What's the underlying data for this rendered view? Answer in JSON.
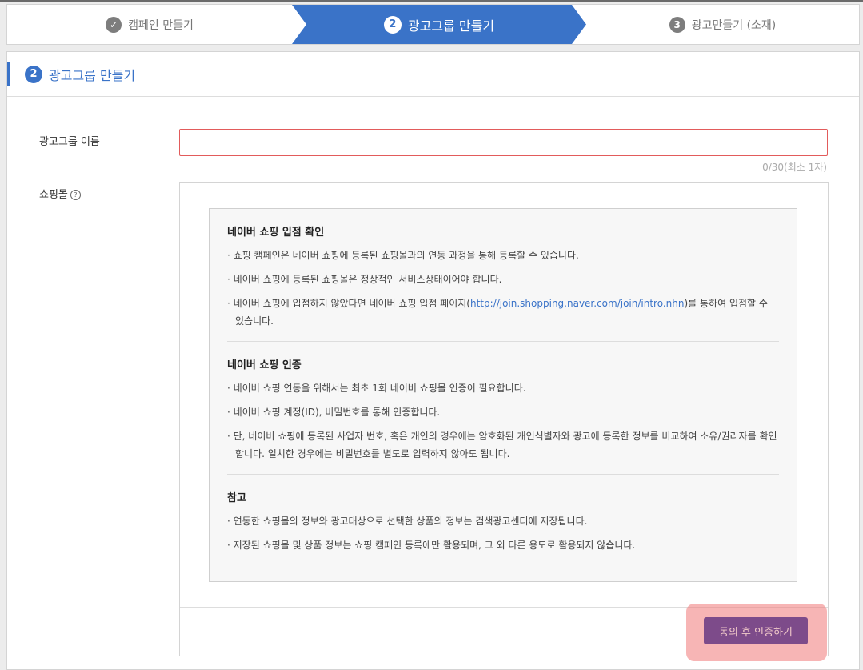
{
  "steps": [
    {
      "label": "캠페인 만들기",
      "marker": "✓"
    },
    {
      "label": "광고그룹 만들기",
      "marker": "2"
    },
    {
      "label": "광고만들기 (소재)",
      "marker": "3"
    }
  ],
  "panel": {
    "step_number": "2",
    "title": "광고그룹 만들기"
  },
  "form": {
    "group_name_label": "광고그룹 이름",
    "group_name_value": "",
    "group_name_counter": "0/30(최소 1자)",
    "shopping_mall_label": "쇼핑몰",
    "help_glyph": "?"
  },
  "info": {
    "sections": [
      {
        "title": "네이버 쇼핑 입점 확인",
        "items": [
          "· 쇼핑 캠페인은 네이버 쇼핑에 등록된 쇼핑몰과의 연동 과정을 통해 등록할 수 있습니다.",
          "· 네이버 쇼핑에 등록된 쇼핑몰은 정상적인 서비스상태이어야 합니다."
        ],
        "link_item_before": "· 네이버 쇼핑에 입점하지 않았다면 네이버 쇼핑 입점 페이지(",
        "link_text": "http://join.shopping.naver.com/join/intro.nhn",
        "link_item_after": ")를 통하여 입점할 수 있습니다."
      },
      {
        "title": "네이버 쇼핑 인증",
        "items": [
          "· 네이버 쇼핑 연동을 위해서는 최초 1회 네이버 쇼핑몰 인증이 필요합니다.",
          "· 네이버 쇼핑 계정(ID), 비밀번호를 통해 인증합니다.",
          "· 단, 네이버 쇼핑에 등록된 사업자 번호, 혹은 개인의 경우에는 암호화된 개인식별자와 광고에 등록한 정보를 비교하여 소유/권리자를 확인합니다. 일치한 경우에는 비밀번호를 별도로 입력하지 않아도 됩니다."
        ]
      },
      {
        "title": "참고",
        "items": [
          "· 연동한 쇼핑몰의 정보와 광고대상으로 선택한 상품의 정보는 검색광고센터에 저장됩니다.",
          "· 저장된 쇼핑몰 및 상품 정보는 쇼핑 캠페인 등록에만 활용되며, 그 외 다른 용도로 활용되지 않습니다."
        ]
      }
    ]
  },
  "cta": {
    "label": "동의 후 인증하기"
  },
  "colors": {
    "accent": "#3a73c8",
    "cta": "#7d4b8a",
    "error_border": "#e25b5b"
  }
}
